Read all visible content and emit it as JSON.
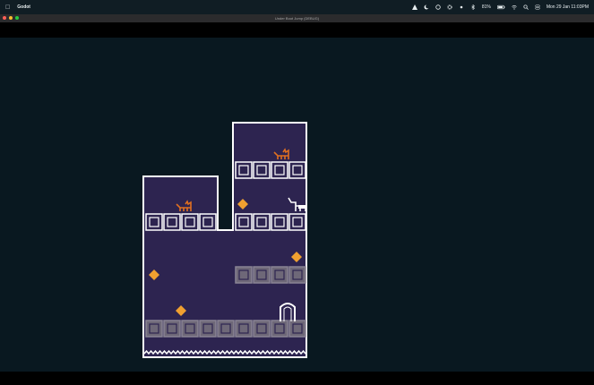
{
  "menubar": {
    "app_name": "Godot",
    "battery_percent": "81%",
    "clock": "Mon 29 Jan  11:03PM",
    "status_icons": [
      "triangle-icon",
      "moon-icon",
      "circle-icon",
      "gear-icon",
      "brightness-icon",
      "bluetooth-icon",
      "battery-icon",
      "wifi-icon",
      "search-icon",
      "control-center-icon"
    ]
  },
  "window": {
    "title": "Under Boot Jump (DEBUG)"
  },
  "colors": {
    "background": "#091820",
    "room_fill": "#2d2450",
    "wall_line": "#ffffff",
    "block_empty": "#2d2450",
    "block_solid": "#6e6878",
    "gem": "#f0a030",
    "cat": "#e07020",
    "player": "#ffffff"
  },
  "level": {
    "gems": 4,
    "cats": 2,
    "player_count": 1,
    "exit_doors": 1
  }
}
